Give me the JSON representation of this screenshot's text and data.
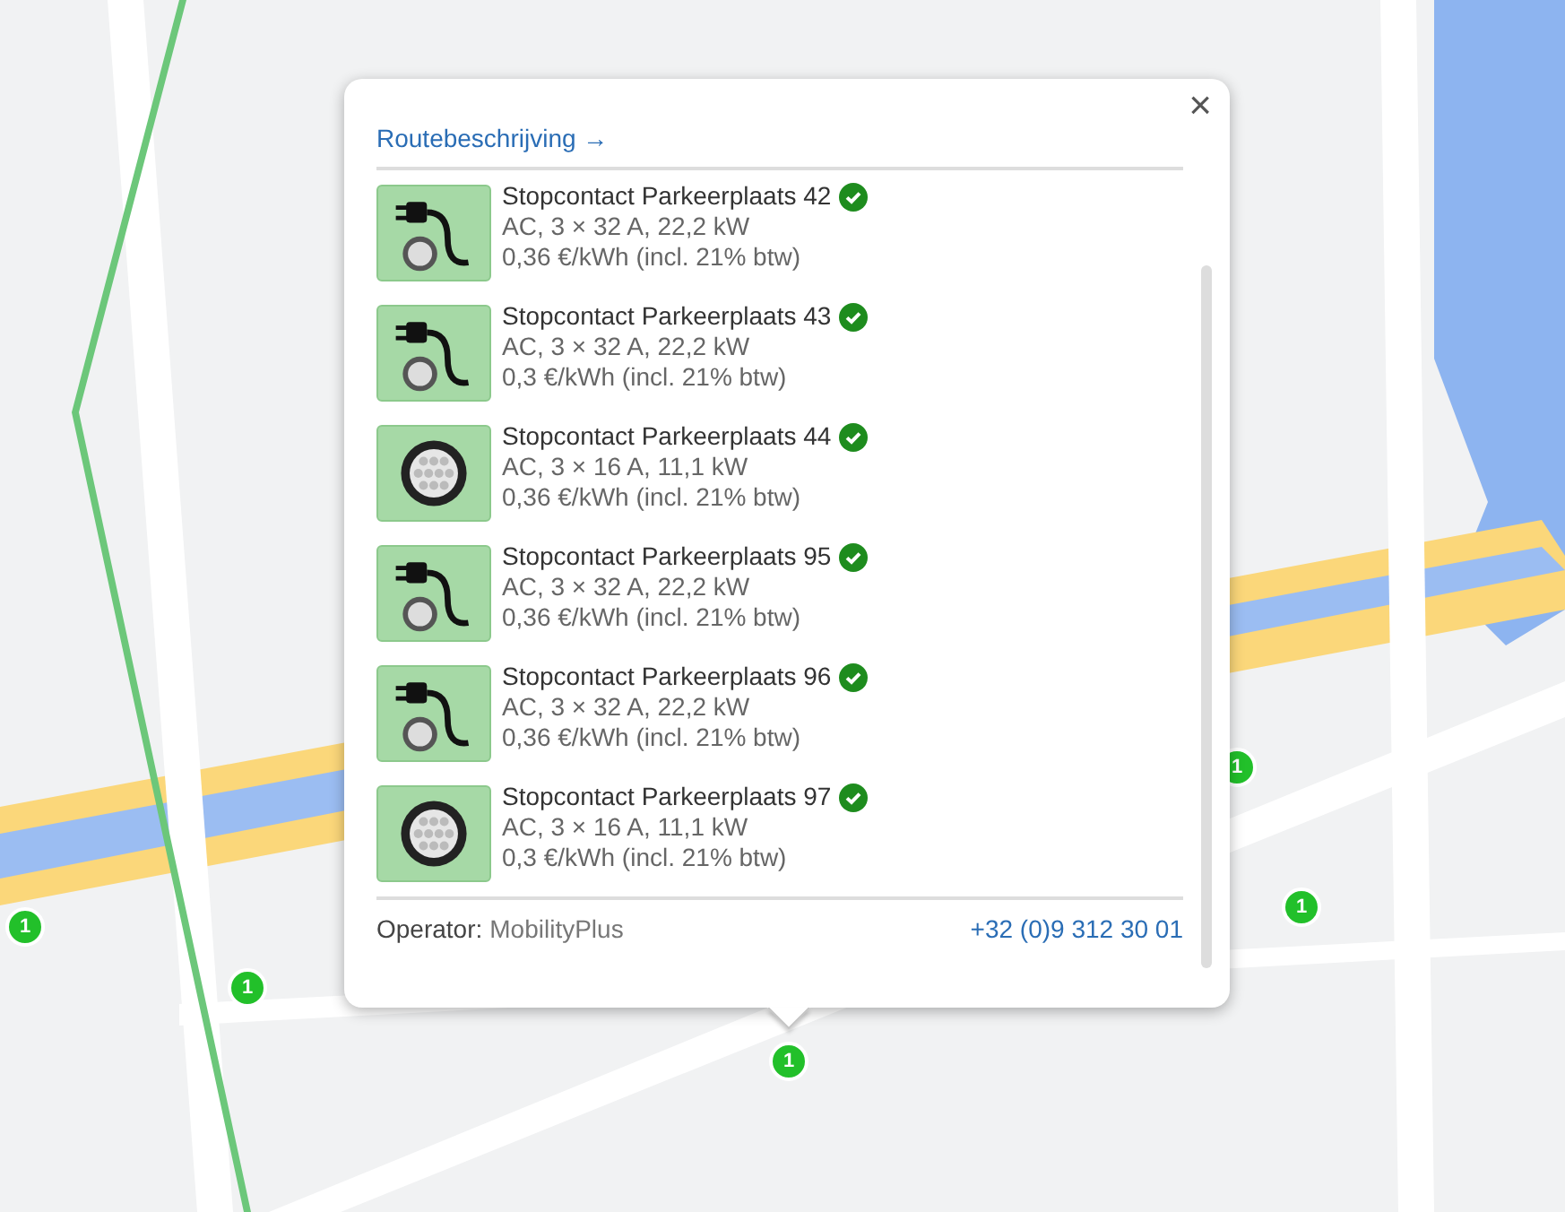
{
  "markers": [
    {
      "label": "1"
    },
    {
      "label": "1"
    },
    {
      "label": "1"
    },
    {
      "label": "1"
    },
    {
      "label": "1"
    }
  ],
  "popup": {
    "route_link": "Routebeschrijving →",
    "close": "×",
    "connectors": [
      {
        "kind": "plug",
        "name": "Stopcontact Parkeerplaats 42",
        "available": true,
        "power": "AC, 3 × 32 A, 22,2 kW",
        "price": "0,36 €/kWh (incl. 21% btw)"
      },
      {
        "kind": "plug",
        "name": "Stopcontact Parkeerplaats 43",
        "available": true,
        "power": "AC, 3 × 32 A, 22,2 kW",
        "price": "0,3 €/kWh (incl. 21% btw)"
      },
      {
        "kind": "socket",
        "name": "Stopcontact Parkeerplaats 44",
        "available": true,
        "power": "AC, 3 × 16 A, 11,1 kW",
        "price": "0,36 €/kWh (incl. 21% btw)"
      },
      {
        "kind": "plug",
        "name": "Stopcontact Parkeerplaats 95",
        "available": true,
        "power": "AC, 3 × 32 A, 22,2 kW",
        "price": "0,36 €/kWh (incl. 21% btw)"
      },
      {
        "kind": "plug",
        "name": "Stopcontact Parkeerplaats 96",
        "available": true,
        "power": "AC, 3 × 32 A, 22,2 kW",
        "price": "0,36 €/kWh (incl. 21% btw)"
      },
      {
        "kind": "socket",
        "name": "Stopcontact Parkeerplaats 97",
        "available": true,
        "power": "AC, 3 × 16 A, 11,1 kW",
        "price": "0,3 €/kWh (incl. 21% btw)"
      }
    ],
    "operator_label": "Operator:",
    "operator": "MobilityPlus",
    "phone": "+32 (0)9 312 30 01"
  }
}
